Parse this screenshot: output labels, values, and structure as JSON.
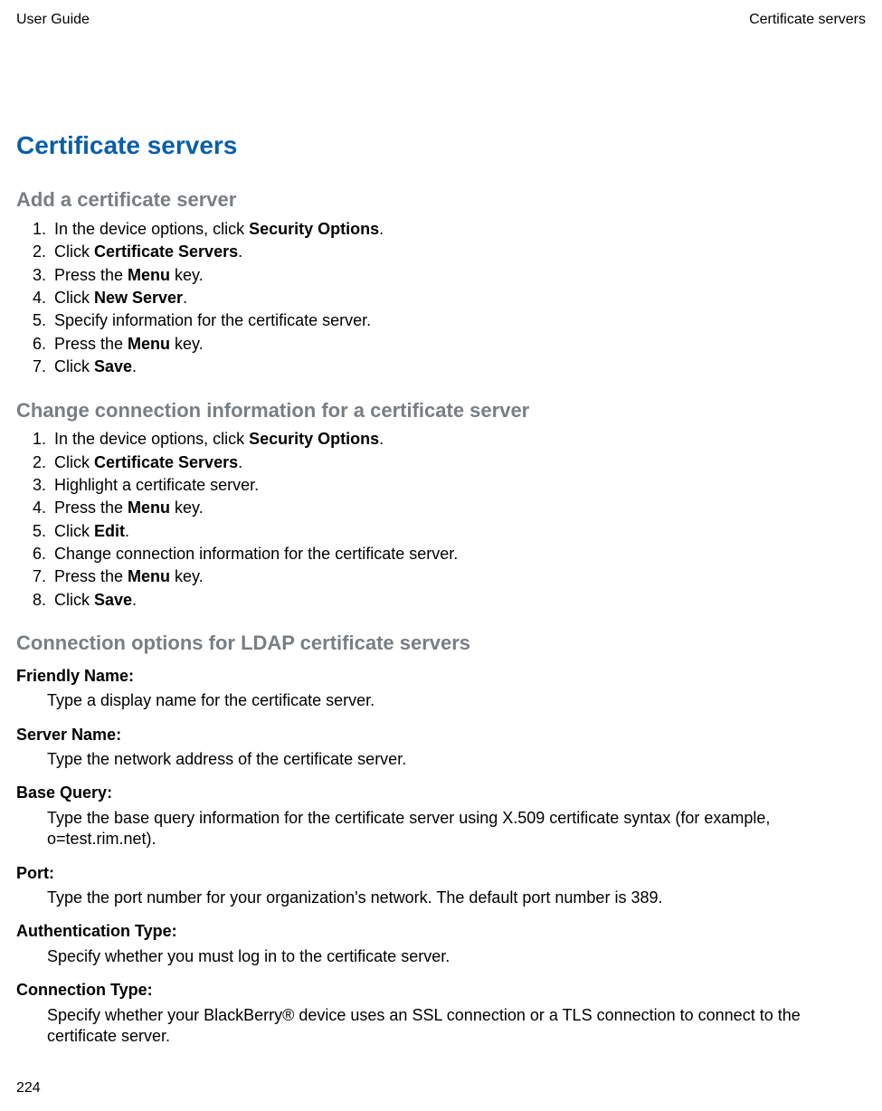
{
  "header": {
    "left": "User Guide",
    "right": "Certificate servers"
  },
  "title": "Certificate servers",
  "sections": {
    "add": {
      "heading": "Add a certificate server",
      "steps": [
        {
          "pre": "In the device options, click ",
          "bold": "Security Options",
          "post": "."
        },
        {
          "pre": "Click ",
          "bold": "Certificate Servers",
          "post": "."
        },
        {
          "pre": "Press the ",
          "bold": "Menu",
          "post": " key."
        },
        {
          "pre": "Click ",
          "bold": "New Server",
          "post": "."
        },
        {
          "pre": "Specify information for the certificate server.",
          "bold": "",
          "post": ""
        },
        {
          "pre": "Press the ",
          "bold": "Menu",
          "post": " key."
        },
        {
          "pre": "Click ",
          "bold": "Save",
          "post": "."
        }
      ]
    },
    "change": {
      "heading": "Change connection information for a certificate server",
      "steps": [
        {
          "pre": "In the device options, click ",
          "bold": "Security Options",
          "post": "."
        },
        {
          "pre": "Click ",
          "bold": "Certificate Servers",
          "post": "."
        },
        {
          "pre": "Highlight a certificate server.",
          "bold": "",
          "post": ""
        },
        {
          "pre": "Press the ",
          "bold": "Menu",
          "post": " key."
        },
        {
          "pre": "Click ",
          "bold": "Edit",
          "post": "."
        },
        {
          "pre": "Change connection information for the certificate server.",
          "bold": "",
          "post": ""
        },
        {
          "pre": "Press the ",
          "bold": "Menu",
          "post": " key."
        },
        {
          "pre": "Click ",
          "bold": "Save",
          "post": "."
        }
      ]
    },
    "options": {
      "heading": "Connection options for LDAP certificate servers",
      "defs": [
        {
          "term": "Friendly Name",
          "body": "Type a display name for the certificate server."
        },
        {
          "term": "Server Name",
          "body": "Type the network address of the certificate server."
        },
        {
          "term": "Base Query",
          "body": "Type the base query information for the certificate server using X.509 certificate syntax (for example, o=test.rim.net)."
        },
        {
          "term": "Port",
          "body": "Type the port number for your organization's network. The default port number is 389."
        },
        {
          "term": "Authentication Type",
          "body": "Specify whether you must log in to the certificate server."
        },
        {
          "term": "Connection Type",
          "body": "Specify whether your BlackBerry® device uses an SSL connection or a TLS connection to connect to the certificate server."
        }
      ]
    }
  },
  "footer": {
    "page": "224"
  }
}
